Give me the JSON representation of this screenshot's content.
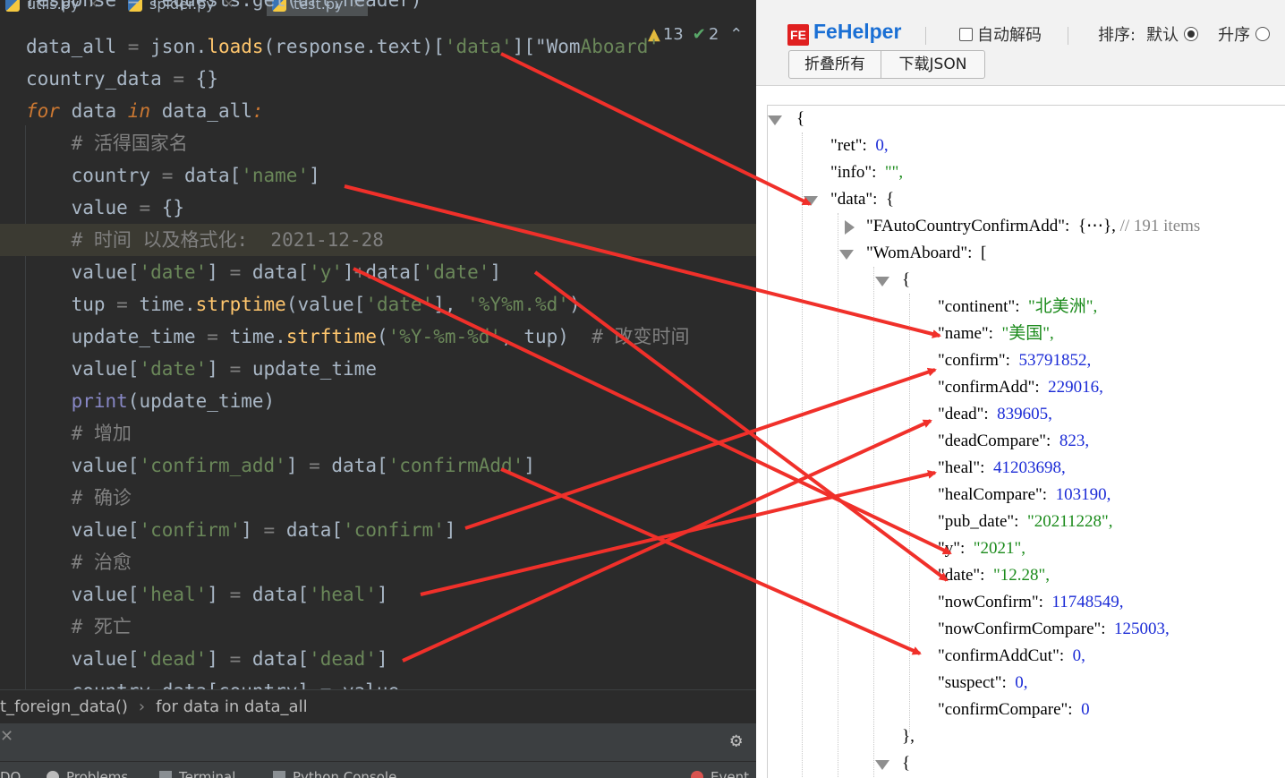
{
  "ide": {
    "tabs": [
      {
        "label": "utils.py"
      },
      {
        "label": "spider.py"
      },
      {
        "label": "test.py"
      }
    ],
    "inspections": {
      "warnings": "13",
      "ok": "2"
    },
    "code_lines": [
      {
        "text": "response = requests.get(url,header)"
      },
      {
        "segs": [
          [
            "",
            "data_all "
          ],
          [
            "gray",
            "= "
          ],
          [
            "",
            "json."
          ],
          [
            "fn",
            "loads"
          ],
          [
            "",
            "(response.text)["
          ],
          [
            "str",
            "'data'"
          ],
          [
            "",
            "][\"Wom"
          ],
          [
            "str",
            "Aboard'"
          ],
          [
            "",
            ""
          ]
        ]
      },
      {
        "segs": [
          [
            "",
            "country_data "
          ],
          [
            "gray",
            "= "
          ],
          [
            "",
            "{}"
          ]
        ]
      },
      {
        "segs": [
          [
            "kw",
            "for"
          ],
          [
            "",
            " data "
          ],
          [
            "kw",
            "in"
          ],
          [
            "",
            " data_all"
          ],
          [
            "kw",
            ":"
          ]
        ]
      },
      {
        "segs": [
          [
            "cm",
            "    # 活得国家名"
          ]
        ]
      },
      {
        "segs": [
          [
            "",
            "    country "
          ],
          [
            "gray",
            "= "
          ],
          [
            "",
            "data["
          ],
          [
            "str",
            "'name'"
          ],
          [
            "",
            "]"
          ]
        ]
      },
      {
        "segs": [
          [
            "",
            "    value "
          ],
          [
            "gray",
            "= "
          ],
          [
            "",
            "{}"
          ]
        ]
      },
      {
        "segs": [
          [
            "cm",
            "    # 时间 以及格式化:  2021-12-28"
          ]
        ]
      },
      {
        "segs": [
          [
            "",
            "    value["
          ],
          [
            "str",
            "'date'"
          ],
          [
            "",
            "] "
          ],
          [
            "gray",
            "= "
          ],
          [
            "",
            "data["
          ],
          [
            "str",
            "'y'"
          ],
          [
            "",
            "]"
          ],
          [
            "gray",
            "+"
          ],
          [
            "",
            "data["
          ],
          [
            "str",
            "'date'"
          ],
          [
            "",
            "]"
          ]
        ]
      },
      {
        "segs": [
          [
            "",
            "    tup "
          ],
          [
            "gray",
            "= "
          ],
          [
            "",
            "time."
          ],
          [
            "fn",
            "strptime"
          ],
          [
            "",
            "(value["
          ],
          [
            "str",
            "'date'"
          ],
          [
            "",
            "], "
          ],
          [
            "str",
            "'%Y%m.%d'"
          ],
          [
            "",
            ")"
          ]
        ]
      },
      {
        "segs": [
          [
            "",
            "    update_time "
          ],
          [
            "gray",
            "= "
          ],
          [
            "",
            "time."
          ],
          [
            "fn",
            "strftime"
          ],
          [
            "",
            "("
          ],
          [
            "str",
            "'%Y-%m-%d'"
          ],
          [
            "",
            ", tup)  "
          ],
          [
            "cm",
            "# 改变时间"
          ]
        ]
      },
      {
        "segs": [
          [
            "",
            "    value["
          ],
          [
            "str",
            "'date'"
          ],
          [
            "",
            "] "
          ],
          [
            "gray",
            "= "
          ],
          [
            "",
            "update_time"
          ]
        ]
      },
      {
        "segs": [
          [
            "bi",
            "    print"
          ],
          [
            "",
            "(update_time)"
          ]
        ]
      },
      {
        "segs": [
          [
            "cm",
            "    # 增加"
          ]
        ]
      },
      {
        "segs": [
          [
            "",
            "    value["
          ],
          [
            "str",
            "'confirm_add'"
          ],
          [
            "",
            "] "
          ],
          [
            "gray",
            "= "
          ],
          [
            "",
            "data["
          ],
          [
            "str",
            "'confirmAdd'"
          ],
          [
            "",
            "]"
          ]
        ]
      },
      {
        "segs": [
          [
            "cm",
            "    # 确诊"
          ]
        ]
      },
      {
        "segs": [
          [
            "",
            "    value["
          ],
          [
            "str",
            "'confirm'"
          ],
          [
            "",
            "] "
          ],
          [
            "gray",
            "= "
          ],
          [
            "",
            "data["
          ],
          [
            "str",
            "'confirm'"
          ],
          [
            "",
            "]"
          ]
        ]
      },
      {
        "segs": [
          [
            "cm",
            "    # 治愈"
          ]
        ]
      },
      {
        "segs": [
          [
            "",
            "    value["
          ],
          [
            "str",
            "'heal'"
          ],
          [
            "",
            "] "
          ],
          [
            "gray",
            "= "
          ],
          [
            "",
            "data["
          ],
          [
            "str",
            "'heal'"
          ],
          [
            "",
            "]"
          ]
        ]
      },
      {
        "segs": [
          [
            "cm",
            "    # 死亡"
          ]
        ]
      },
      {
        "segs": [
          [
            "",
            "    value["
          ],
          [
            "str",
            "'dead'"
          ],
          [
            "",
            "] "
          ],
          [
            "gray",
            "= "
          ],
          [
            "",
            "data["
          ],
          [
            "str",
            "'dead'"
          ],
          [
            "",
            "]"
          ]
        ]
      },
      {
        "segs": [
          [
            "",
            "    country_data[country] = value"
          ]
        ]
      }
    ],
    "breadcrumb": [
      "t_foreign_data()",
      "for data in data_all"
    ],
    "tool_windows": [
      "DO",
      "Problems",
      "Terminal",
      "Python Console",
      "Event"
    ]
  },
  "fehelper": {
    "title": "FeHelper",
    "logo_text": "FE",
    "auto_decode_label": "自动解码",
    "sort_label": "排序:",
    "sort_default": "默认",
    "sort_asc": "升序",
    "fold_all_button": "折叠所有",
    "download_json_button": "下载JSON",
    "json": {
      "open_brace": "{",
      "ret_key": "\"ret\":",
      "ret_val": "0,",
      "info_key": "\"info\":",
      "info_val": "\"\",",
      "data_key": "\"data\":",
      "data_open": "{",
      "fauto_key": "\"FAutoCountryConfirmAdd\":",
      "fauto_val": "{⋯},",
      "fauto_comment": "// 191 items",
      "womaboard_key": "\"WomAboard\":",
      "womaboard_open": "[",
      "item_open": "{",
      "fields": [
        {
          "k": "\"continent\":",
          "v": "\"北美洲\",",
          "t": "s"
        },
        {
          "k": "\"name\":",
          "v": "\"美国\",",
          "t": "s"
        },
        {
          "k": "\"confirm\":",
          "v": "53791852,",
          "t": "n"
        },
        {
          "k": "\"confirmAdd\":",
          "v": "229016,",
          "t": "n"
        },
        {
          "k": "\"dead\":",
          "v": "839605,",
          "t": "n"
        },
        {
          "k": "\"deadCompare\":",
          "v": "823,",
          "t": "n"
        },
        {
          "k": "\"heal\":",
          "v": "41203698,",
          "t": "n"
        },
        {
          "k": "\"healCompare\":",
          "v": "103190,",
          "t": "n"
        },
        {
          "k": "\"pub_date\":",
          "v": "\"20211228\",",
          "t": "s"
        },
        {
          "k": "\"y\":",
          "v": "\"2021\",",
          "t": "s"
        },
        {
          "k": "\"date\":",
          "v": "\"12.28\",",
          "t": "s"
        },
        {
          "k": "\"nowConfirm\":",
          "v": "11748549,",
          "t": "n"
        },
        {
          "k": "\"nowConfirmCompare\":",
          "v": "125003,",
          "t": "n"
        },
        {
          "k": "\"confirmAddCut\":",
          "v": "0,",
          "t": "n"
        },
        {
          "k": "\"suspect\":",
          "v": "0,",
          "t": "n"
        },
        {
          "k": "\"confirmCompare\":",
          "v": "0",
          "t": "n"
        }
      ],
      "item_close": "},",
      "next_item_open": "{"
    }
  },
  "colors": {
    "annotation_arrow": "#f0302a"
  }
}
